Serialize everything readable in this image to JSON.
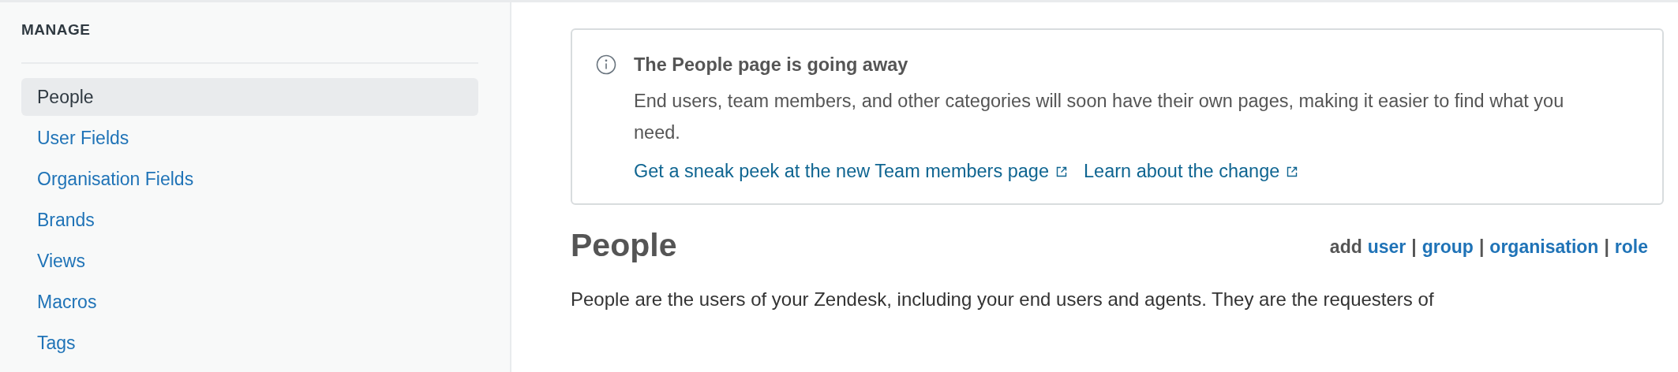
{
  "sidebar": {
    "heading": "MANAGE",
    "items": [
      {
        "label": "People",
        "selected": true
      },
      {
        "label": "User Fields",
        "selected": false
      },
      {
        "label": "Organisation Fields",
        "selected": false
      },
      {
        "label": "Brands",
        "selected": false
      },
      {
        "label": "Views",
        "selected": false
      },
      {
        "label": "Macros",
        "selected": false
      },
      {
        "label": "Tags",
        "selected": false
      }
    ]
  },
  "notice": {
    "title": "The People page is going away",
    "body": "End users, team members, and other categories will soon have their own pages, making it easier to find what you need.",
    "links": [
      {
        "label": "Get a sneak peek at the new Team members page"
      },
      {
        "label": "Learn about the change"
      }
    ]
  },
  "page": {
    "title": "People",
    "actions": [
      {
        "kind": "label",
        "text": "add"
      },
      {
        "kind": "link",
        "text": "user"
      },
      {
        "kind": "separator",
        "text": "|"
      },
      {
        "kind": "link",
        "text": "group"
      },
      {
        "kind": "separator",
        "text": "|"
      },
      {
        "kind": "link",
        "text": "organisation"
      },
      {
        "kind": "separator",
        "text": "|"
      },
      {
        "kind": "link",
        "text": "role"
      }
    ],
    "description": "People are the users of your Zendesk, including your end users and agents. They are the requesters of"
  }
}
